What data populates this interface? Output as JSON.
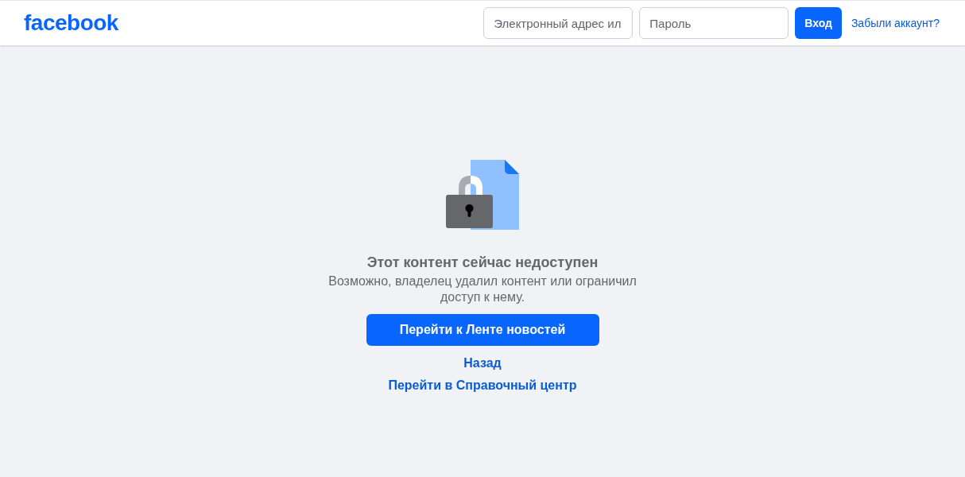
{
  "header": {
    "logo": "facebook",
    "email_field": {
      "placeholder": "Электронный адрес ил"
    },
    "password_field": {
      "placeholder": "Пароль"
    },
    "login_button": "Вход",
    "forgot_link": "Забыли аккаунт?"
  },
  "message": {
    "title": "Этот контент сейчас недоступен",
    "body": "Возможно, владелец удалил контент или ограничил доступ к нему.",
    "primary_button": "Перейти к Ленте новостей",
    "links": [
      "Назад",
      "Перейти в Справочный центр"
    ]
  }
}
